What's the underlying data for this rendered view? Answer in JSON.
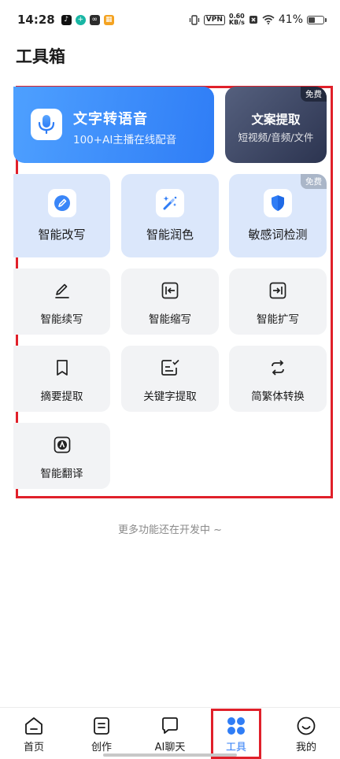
{
  "status_bar": {
    "time": "14:28",
    "vpn": "VPN",
    "speed_value": "0.60",
    "speed_unit": "KB/s",
    "battery": "41%",
    "battery_level": 0.41
  },
  "page": {
    "title": "工具箱",
    "footer_note": "更多功能还在开发中 ~"
  },
  "featured": {
    "tts": {
      "title": "文字转语音",
      "subtitle": "100+AI主播在线配音",
      "icon": "microphone-icon"
    },
    "extract": {
      "title": "文案提取",
      "subtitle": "短视频/音频/文件",
      "badge": "免费"
    }
  },
  "primary_tools": [
    {
      "label": "智能改写",
      "icon": "pen-circle-icon"
    },
    {
      "label": "智能润色",
      "icon": "magic-wand-icon"
    },
    {
      "label": "敏感词检测",
      "icon": "shield-icon",
      "badge": "免费"
    }
  ],
  "secondary_tools": [
    {
      "label": "智能续写",
      "icon": "pencil-icon"
    },
    {
      "label": "智能缩写",
      "icon": "collapse-icon"
    },
    {
      "label": "智能扩写",
      "icon": "expand-icon"
    },
    {
      "label": "摘要提取",
      "icon": "bookmark-icon"
    },
    {
      "label": "关键字提取",
      "icon": "doc-check-icon"
    },
    {
      "label": "简繁体转换",
      "icon": "refresh-icon"
    },
    {
      "label": "智能翻译",
      "icon": "translate-icon"
    }
  ],
  "bottom_nav": [
    {
      "label": "首页",
      "icon": "home-icon"
    },
    {
      "label": "创作",
      "icon": "document-icon"
    },
    {
      "label": "AI聊天",
      "icon": "chat-icon"
    },
    {
      "label": "工具",
      "icon": "grid-icon",
      "active": true
    },
    {
      "label": "我的",
      "icon": "smile-icon"
    }
  ],
  "colors": {
    "accent": "#2f7df6",
    "highlight_border": "#e0202a",
    "blue_card": "#dbe7fb",
    "gray_card": "#f2f3f5"
  }
}
